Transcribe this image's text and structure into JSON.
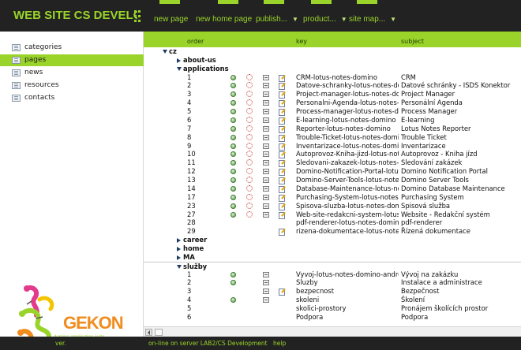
{
  "header": {
    "title": "WEB SITE CS DEVELO",
    "nav": [
      {
        "label": "new page",
        "dropdown": false
      },
      {
        "label": "new home page",
        "dropdown": false
      },
      {
        "label": "publish...",
        "dropdown": true
      },
      {
        "label": "product...",
        "dropdown": true
      },
      {
        "label": "site map...",
        "dropdown": true
      }
    ]
  },
  "sidebar": {
    "items": [
      {
        "label": "categories",
        "active": false
      },
      {
        "label": "pages",
        "active": true
      },
      {
        "label": "news",
        "active": false
      },
      {
        "label": "resources",
        "active": false
      },
      {
        "label": "contacts",
        "active": false
      }
    ],
    "logo": {
      "name": "GEKON",
      "tagline": "domino application suite"
    }
  },
  "table": {
    "columns": {
      "order": "order",
      "key": "key",
      "subject": "subject"
    },
    "rows": [
      {
        "level": 0,
        "open": true,
        "label": "cz"
      },
      {
        "level": 1,
        "open": false,
        "label": "about-us"
      },
      {
        "level": 1,
        "open": true,
        "label": "applications"
      },
      {
        "order": "1",
        "icons": [
          1,
          1,
          1,
          1
        ],
        "key": "CRM-lotus-notes-domino",
        "subject": "CRM"
      },
      {
        "order": "2",
        "icons": [
          1,
          1,
          1,
          1
        ],
        "key": "Datove-schranky-lotus-notes-domino",
        "subject": "Datové schránky - ISDS Konektor"
      },
      {
        "order": "3",
        "icons": [
          1,
          1,
          1,
          1
        ],
        "key": "Project-manager-lotus-notes-domino",
        "subject": "Project Manager"
      },
      {
        "order": "4",
        "icons": [
          1,
          1,
          1,
          1
        ],
        "key": "Personalni-Agenda-lotus-notes-domino",
        "subject": "Personální Agenda"
      },
      {
        "order": "5",
        "icons": [
          1,
          1,
          1,
          1
        ],
        "key": "Process-manager-lotus-notes-domino",
        "subject": "Process Manager"
      },
      {
        "order": "6",
        "icons": [
          1,
          1,
          1,
          1
        ],
        "key": "E-learning-lotus-notes-domino",
        "subject": "E-learning"
      },
      {
        "order": "7",
        "icons": [
          1,
          1,
          1,
          1
        ],
        "key": "Reporter-lotus-notes-domino",
        "subject": "Lotus Notes Reporter"
      },
      {
        "order": "8",
        "icons": [
          1,
          1,
          1,
          1
        ],
        "key": "Trouble-Ticket-lotus-notes-domino",
        "subject": "Trouble Ticket"
      },
      {
        "order": "9",
        "icons": [
          1,
          1,
          1,
          1
        ],
        "key": "Inventarizace-lotus-notes-domino",
        "subject": "Inventarizace"
      },
      {
        "order": "10",
        "icons": [
          1,
          1,
          1,
          1
        ],
        "key": "Autoprovoz-Kniha-jizd-lotus-notes-domino",
        "subject": "Autoprovoz - Kniha jízd"
      },
      {
        "order": "11",
        "icons": [
          1,
          1,
          1,
          1
        ],
        "key": "Sledovani-zakazek-lotus-notes-domino",
        "subject": "Sledování zakázek"
      },
      {
        "order": "12",
        "icons": [
          1,
          1,
          1,
          1
        ],
        "key": "Domino-Notification-Portal-lotus-notes",
        "subject": "Domino Notification Portal"
      },
      {
        "order": "13",
        "icons": [
          1,
          1,
          1,
          1
        ],
        "key": "Domino-Server-Tools-lotus-notes-domino",
        "subject": "Domino Server Tools"
      },
      {
        "order": "14",
        "icons": [
          1,
          1,
          1,
          1
        ],
        "key": "Database-Maintenance-lotus-notes-domino",
        "subject": "Domino Database Maintenance"
      },
      {
        "order": "17",
        "icons": [
          1,
          1,
          1,
          1
        ],
        "key": "Purchasing-System-lotus-notes-domino",
        "subject": "Purchasing System"
      },
      {
        "order": "23",
        "icons": [
          1,
          1,
          1,
          1
        ],
        "key": "Spisova-sluzba-lotus-notes-domino",
        "subject": "Spisová služba"
      },
      {
        "order": "27",
        "icons": [
          1,
          1,
          1,
          1
        ],
        "key": "Web-site-redakcni-system-lotus-notes",
        "subject": "Website - Redakční systém"
      },
      {
        "order": "28",
        "icons": [
          0,
          0,
          0,
          0
        ],
        "key": "pdf-renderer-lotus-notes-domino",
        "subject": "pdf-renderer"
      },
      {
        "order": "29",
        "icons": [
          0,
          0,
          0,
          1
        ],
        "key": "rizena-dokumentace-lotus-notes-domino",
        "subject": "Řízená dokumentace"
      },
      {
        "level": 1,
        "open": false,
        "label": "career"
      },
      {
        "level": 1,
        "open": false,
        "label": "home"
      },
      {
        "level": 1,
        "open": false,
        "label": "MA"
      },
      {
        "level": 1,
        "open": true,
        "label": "služby",
        "sep": true
      },
      {
        "order": "1",
        "icons": [
          1,
          0,
          1,
          0
        ],
        "key": "Vyvoj-lotus-notes-domino-android",
        "subject": "Vývoj na zakázku"
      },
      {
        "order": "2",
        "icons": [
          1,
          0,
          1,
          0
        ],
        "key": "Sluzby",
        "subject": "Instalace a administrace"
      },
      {
        "order": "3",
        "icons": [
          0,
          0,
          1,
          1
        ],
        "key": "bezpecnost",
        "subject": "Bezpečnost"
      },
      {
        "order": "4",
        "icons": [
          1,
          0,
          1,
          0
        ],
        "key": "skoleni",
        "subject": "Školení"
      },
      {
        "order": "5",
        "icons": [
          0,
          0,
          0,
          0
        ],
        "key": "skolici-prostory",
        "subject": "Pronájem školících prostor"
      },
      {
        "order": "6",
        "icons": [
          0,
          0,
          0,
          0
        ],
        "key": "Podpora",
        "subject": "Podpora"
      }
    ]
  },
  "footer": {
    "ver": "ver.",
    "status": "on-line on server LAB2/CS Development",
    "help": "help"
  },
  "colors": {
    "accent": "#9ad42a",
    "dark": "#222222"
  }
}
